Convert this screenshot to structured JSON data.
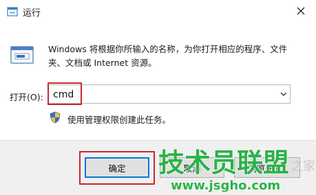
{
  "window": {
    "title": "运行",
    "close_glyph": "✕"
  },
  "content": {
    "description": "Windows 将根据你所输入的名称，为你打开相应的程序、文件夹、文档或 Internet 资源。",
    "open_label": "打开(O):",
    "open_value": "cmd",
    "admin_note": "使用管理权限创建此任务。"
  },
  "buttons": {
    "ok": "确定",
    "cancel": "取消",
    "browse": "浏览(B)..."
  },
  "watermark": {
    "brand": "技术员联盟",
    "url": "www.jsgho.com",
    "extra": "之家"
  },
  "colors": {
    "highlight": "#c8282e",
    "watermark_green": "#2cb14a",
    "accent": "#0078d7"
  },
  "icons": [
    "run-app-icon",
    "run-dialog-icon",
    "close-icon",
    "chevron-down-icon",
    "uac-shield-icon"
  ]
}
